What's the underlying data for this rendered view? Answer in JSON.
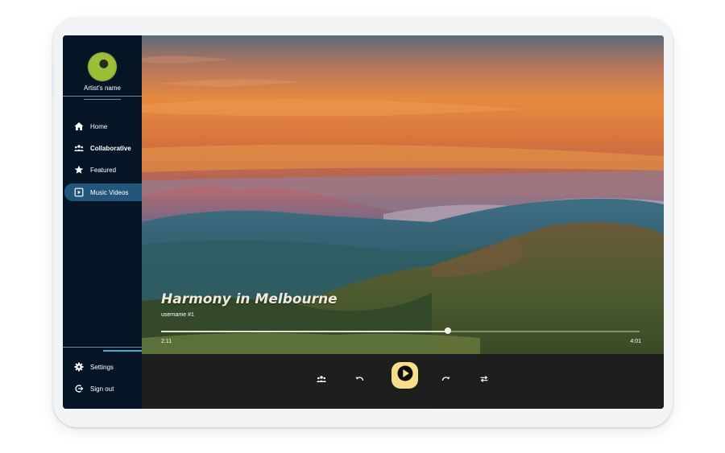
{
  "sidebar": {
    "artist_name": "Artist's name",
    "nav": [
      {
        "label": "Home",
        "icon": "home-icon"
      },
      {
        "label": "Collaborative",
        "icon": "group-icon"
      },
      {
        "label": "Featured",
        "icon": "star-icon"
      },
      {
        "label": "Music Videos",
        "icon": "video-icon",
        "active": true
      }
    ],
    "footer": [
      {
        "label": "Settings",
        "icon": "gear-icon"
      },
      {
        "label": "Sign out",
        "icon": "sign-out-icon"
      }
    ]
  },
  "player": {
    "title": "Harmony in Melbourne",
    "username": "username #1",
    "elapsed": "2:11",
    "total": "4:01",
    "progress": 0.6
  },
  "controls": {
    "collaborators_icon": "group-icon",
    "rewind_icon": "undo-icon",
    "play_icon": "play-icon",
    "forward_icon": "redo-icon",
    "repeat_icon": "repeat-icon"
  },
  "colors": {
    "sidebar_bg": "#061526",
    "active_item_bg": "#22567a",
    "play_button": "#f8dd8a",
    "accent_line": "#4aa3d6"
  }
}
